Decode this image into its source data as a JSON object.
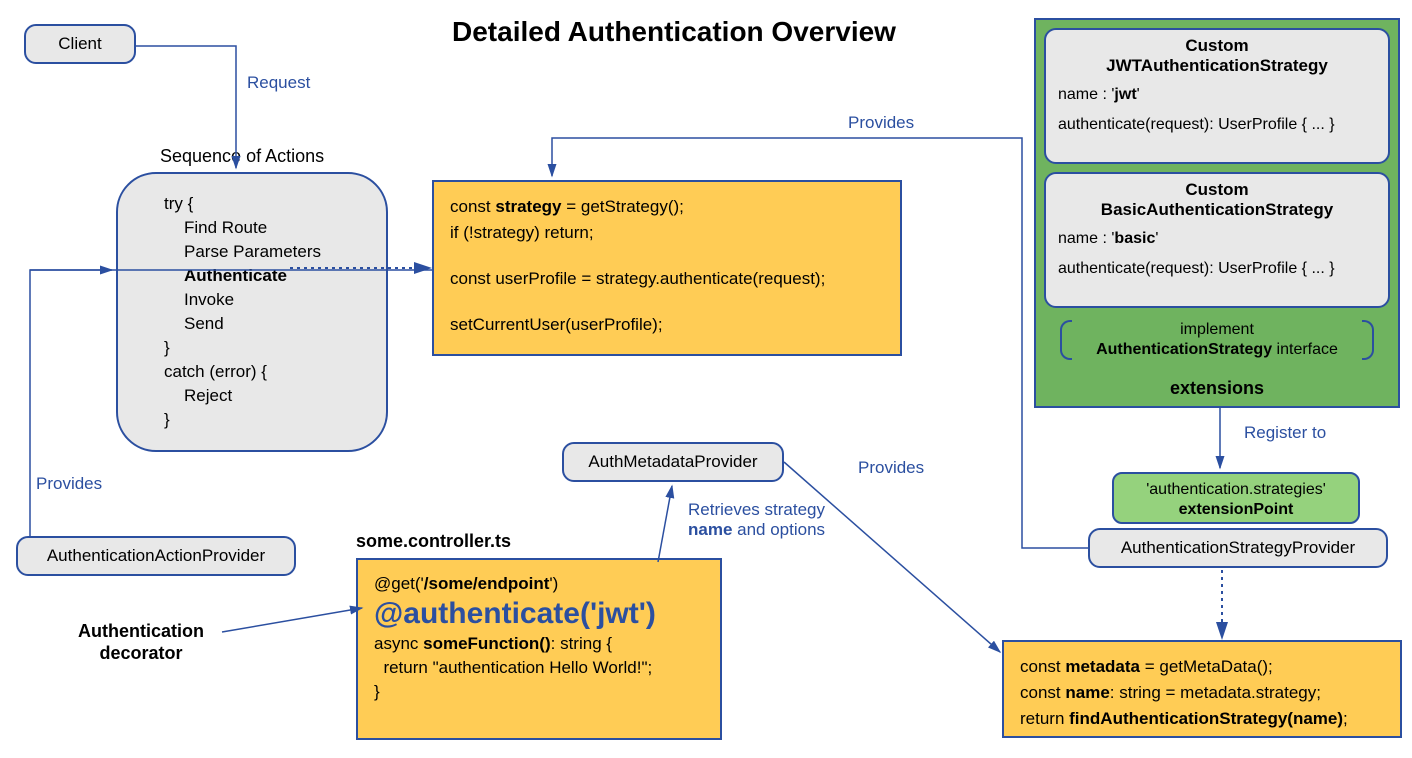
{
  "title": "Detailed Authentication Overview",
  "client": "Client",
  "labels": {
    "request": "Request",
    "providesLeft": "Provides",
    "providesTop": "Provides",
    "providesMid": "Provides",
    "registerTo": "Register to",
    "retrieve1": "Retrieves strategy",
    "retrieve2a": "name",
    "retrieve2b": " and options",
    "seqTitle": "Sequence of Actions",
    "authDecorator1": "Authentication",
    "authDecorator2": "decorator",
    "controllerFile": "some.controller.ts"
  },
  "seq": {
    "l1": "try {",
    "l2": "Find Route",
    "l3": "Parse Parameters",
    "l4": "Authenticate",
    "l5": "Invoke",
    "l6": "Send",
    "l7": "}",
    "l8": "catch (error) {",
    "l9": "Reject",
    "l10": "}"
  },
  "authActionProvider": "AuthenticationActionProvider",
  "strategyCode": {
    "l1a": "const ",
    "l1b": "strategy",
    "l1c": " = getStrategy();",
    "l2": "if (!strategy) return;",
    "l3": "const userProfile = strategy.authenticate(request);",
    "l4": "setCurrentUser(userProfile);"
  },
  "controller": {
    "l1a": "@get('",
    "l1b": "/some/endpoint",
    "l1c": "')",
    "l2": "@authenticate('jwt')",
    "l3a": "async ",
    "l3b": "someFunction()",
    "l3c": ": string {",
    "l4": "  return \"authentication Hello World!\";",
    "l5": "}"
  },
  "authMetaProvider": "AuthMetadataProvider",
  "jwt": {
    "t1": "Custom",
    "t2": "JWTAuthenticationStrategy",
    "l1a": "name : '",
    "l1b": "jwt",
    "l1c": "'",
    "l2": "authenticate(request): UserProfile { ... }"
  },
  "basic": {
    "t1": "Custom",
    "t2": "BasicAuthenticationStrategy",
    "l1a": "name : '",
    "l1b": "basic",
    "l1c": "'",
    "l2": "authenticate(request): UserProfile { ... }"
  },
  "implement": {
    "l1": "implement",
    "l2a": "AuthenticationStrategy",
    "l2b": " interface"
  },
  "extensions": "extensions",
  "extPoint": {
    "l1": "'authentication.strategies'",
    "l2": "extensionPoint"
  },
  "strategyProvider": "AuthenticationStrategyProvider",
  "resolveCode": {
    "l1a": "const ",
    "l1b": "metadata",
    "l1c": " = getMetaData();",
    "l2a": "const ",
    "l2b": "name",
    "l2c": ": string = metadata.strategy;",
    "l3a": "return ",
    "l3b": "findAuthenticationStrategy(name)",
    "l3c": ";"
  }
}
